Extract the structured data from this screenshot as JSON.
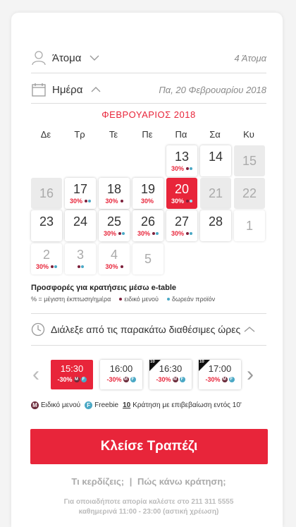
{
  "people": {
    "label": "Άτομα",
    "value": "4 Άτομα"
  },
  "date": {
    "label": "Ημέρα",
    "value": "Πα, 20 Φεβρουαρίου 2018"
  },
  "calendar": {
    "month": "ΦΕΒΡΟΥΑΡΙΟΣ 2018",
    "weekdays": [
      "Δε",
      "Τρ",
      "Τε",
      "Πε",
      "Πα",
      "Σα",
      "Κυ"
    ],
    "days": [
      {
        "num": "13",
        "state": "active",
        "pct": "30%",
        "m": true,
        "f": true
      },
      {
        "num": "14",
        "state": "active",
        "pct": "",
        "m": false,
        "f": false
      },
      {
        "num": "15",
        "state": "disabled",
        "pct": "",
        "m": false,
        "f": false
      },
      {
        "num": "16",
        "state": "disabled",
        "pct": "",
        "m": false,
        "f": false
      },
      {
        "num": "17",
        "state": "active",
        "pct": "30%",
        "m": true,
        "f": true
      },
      {
        "num": "18",
        "state": "active",
        "pct": "30%",
        "m": true,
        "f": false
      },
      {
        "num": "19",
        "state": "active",
        "pct": "30%",
        "m": false,
        "f": false
      },
      {
        "num": "20",
        "state": "selected",
        "pct": "30%",
        "m": true,
        "f": true
      },
      {
        "num": "21",
        "state": "disabled",
        "pct": "",
        "m": false,
        "f": false
      },
      {
        "num": "22",
        "state": "disabled",
        "pct": "",
        "m": false,
        "f": false
      },
      {
        "num": "23",
        "state": "active",
        "pct": "",
        "m": false,
        "f": false
      },
      {
        "num": "24",
        "state": "active",
        "pct": "",
        "m": false,
        "f": false
      },
      {
        "num": "25",
        "state": "active",
        "pct": "30%",
        "m": true,
        "f": true
      },
      {
        "num": "26",
        "state": "active",
        "pct": "30%",
        "m": true,
        "f": true
      },
      {
        "num": "27",
        "state": "active",
        "pct": "30%",
        "m": true,
        "f": true
      },
      {
        "num": "28",
        "state": "active",
        "pct": "",
        "m": false,
        "f": false
      },
      {
        "num": "1",
        "state": "plain",
        "pct": "",
        "m": false,
        "f": false
      },
      {
        "num": "2",
        "state": "plaingray",
        "pct": "30%",
        "m": true,
        "f": true
      },
      {
        "num": "3",
        "state": "plaingray",
        "pct": "",
        "m": true,
        "f": true
      },
      {
        "num": "4",
        "state": "plaingray",
        "pct": "30%",
        "m": true,
        "f": false
      },
      {
        "num": "5",
        "state": "plain",
        "pct": "",
        "m": false,
        "f": false
      }
    ]
  },
  "offers": {
    "title": "Προσφορές για κρατήσεις μέσω e-table",
    "pct_legend": "% = μέγιστη έκπτωση/ημέρα",
    "menu_legend": "ειδικό μενού",
    "free_legend": "δωρεάν προϊόν"
  },
  "time_prompt": "Διάλεξε από τις παρακάτω διαθέσιμες ώρες",
  "slots": [
    {
      "time": "15:30",
      "disc": "-30%",
      "m": true,
      "f": true,
      "ten": false,
      "selected": true
    },
    {
      "time": "16:00",
      "disc": "-30%",
      "m": true,
      "f": true,
      "ten": false,
      "selected": false
    },
    {
      "time": "16:30",
      "disc": "-30%",
      "m": true,
      "f": true,
      "ten": true,
      "selected": false
    },
    {
      "time": "17:00",
      "disc": "-30%",
      "m": true,
      "f": true,
      "ten": true,
      "selected": false
    }
  ],
  "slot_legend": {
    "menu": "Ειδικό μενού",
    "menu_badge": "M",
    "free": "Freebie",
    "free_badge": "F",
    "ten": "10",
    "ten_text": "Κράτηση με επιβεβαίωση εντός 10'"
  },
  "cta": "Κλείσε Τραπέζι",
  "links": {
    "benefits": "Τι κερδίζεις;",
    "sep": "|",
    "how": "Πώς κάνω κράτηση;"
  },
  "support": {
    "line1": "Για οποιαδήποτε απορία καλέστε στο 211 311 5555",
    "line2": "καθημερινά 11:00 - 23:00 (αστική χρέωση)"
  },
  "colors": {
    "accent": "#e8253a",
    "menu_dot": "#7d1f3a",
    "free_dot": "#4aa8c5"
  },
  "icons": {
    "people": "person-icon",
    "date": "calendar-icon",
    "time": "clock-icon"
  }
}
